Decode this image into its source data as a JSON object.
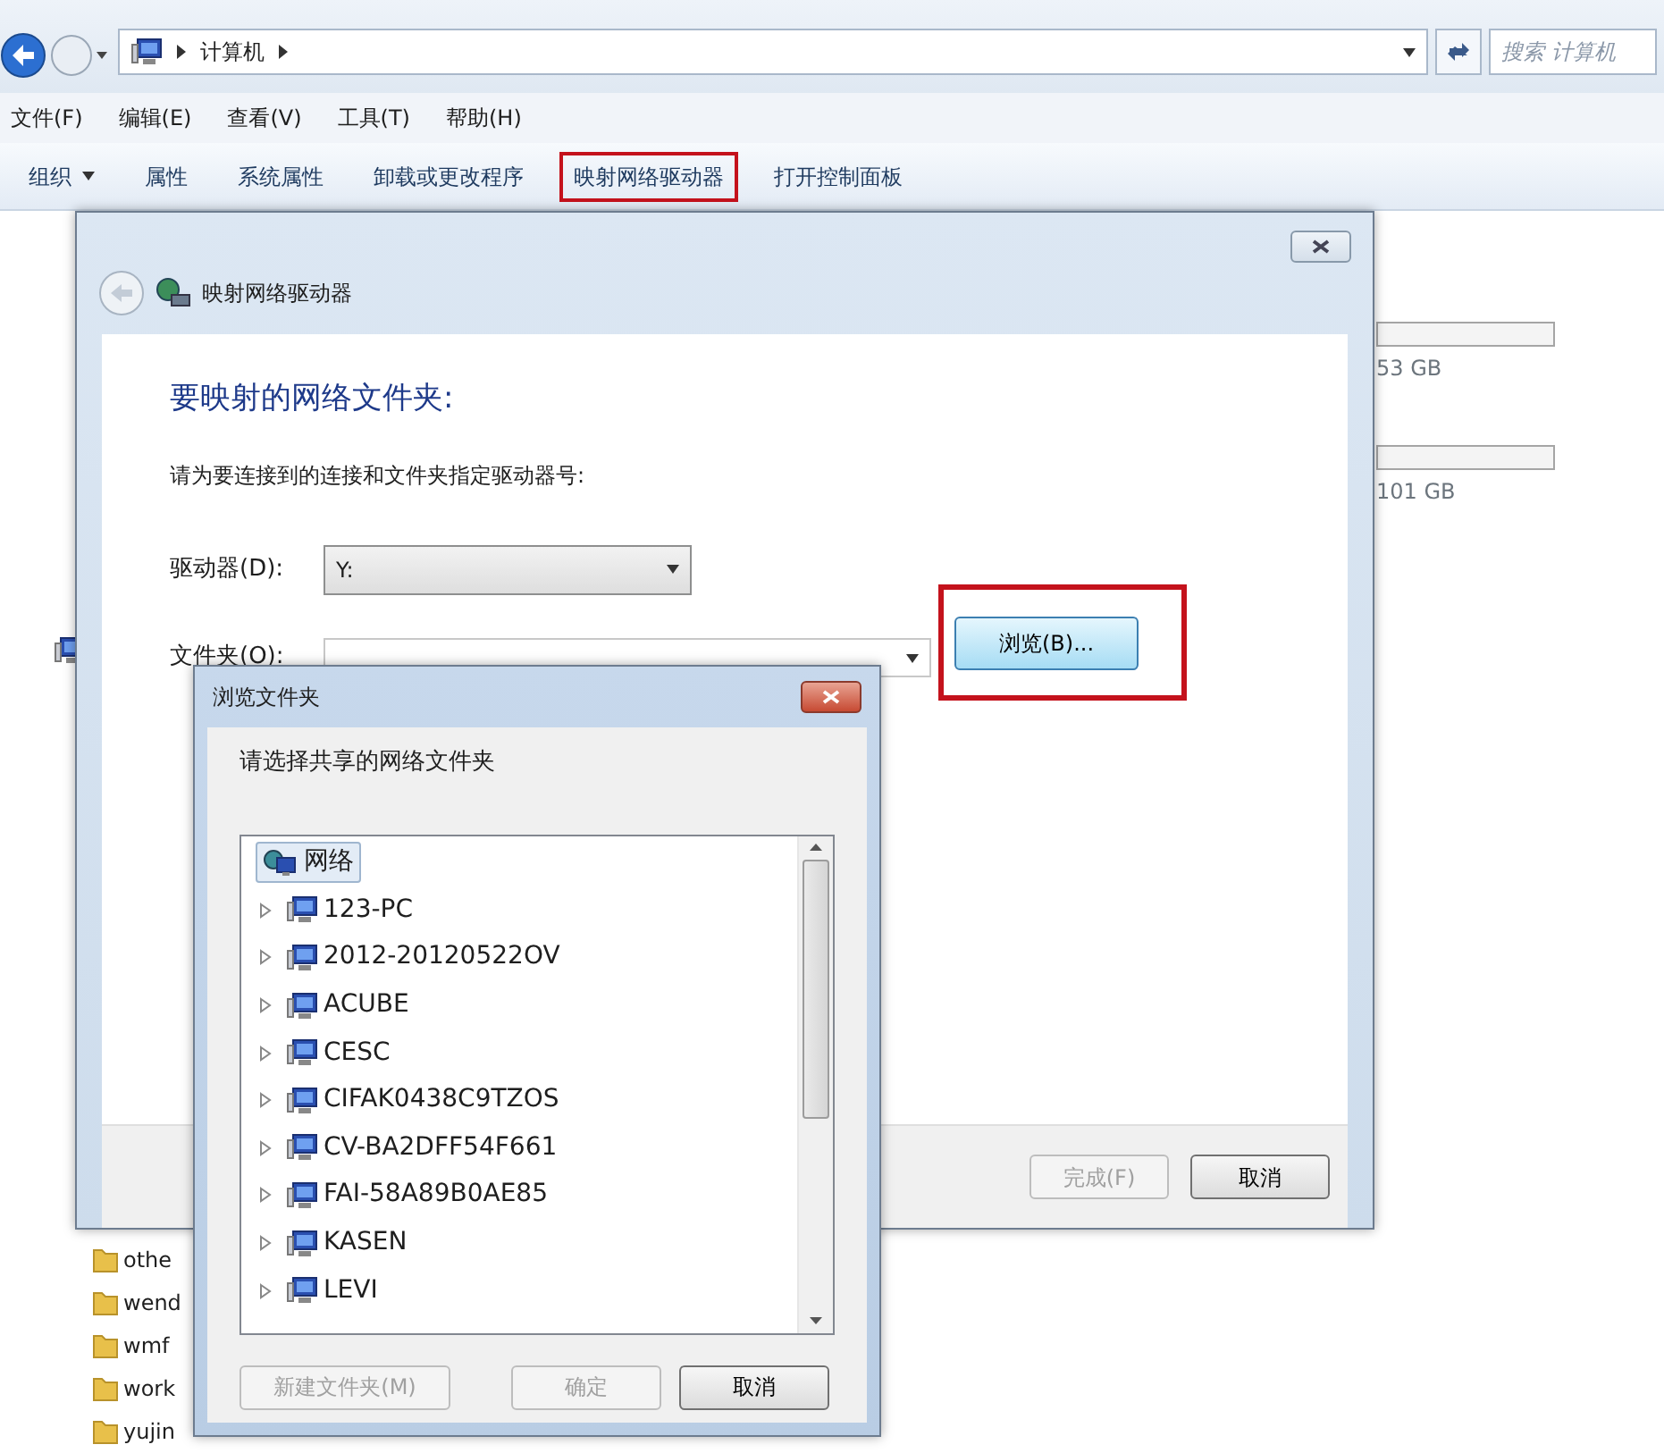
{
  "address_bar": {
    "segments": [
      "计算机"
    ]
  },
  "search": {
    "placeholder": "搜索 计算机"
  },
  "menu": [
    "文件(F)",
    "编辑(E)",
    "查看(V)",
    "工具(T)",
    "帮助(H)"
  ],
  "toolbar": [
    {
      "label": "组织",
      "dropdown": true,
      "highlighted": false
    },
    {
      "label": "属性",
      "dropdown": false,
      "highlighted": false
    },
    {
      "label": "系统属性",
      "dropdown": false,
      "highlighted": false
    },
    {
      "label": "卸载或更改程序",
      "dropdown": false,
      "highlighted": false
    },
    {
      "label": "映射网络驱动器",
      "dropdown": false,
      "highlighted": true
    },
    {
      "label": "打开控制面板",
      "dropdown": false,
      "highlighted": false
    }
  ],
  "drives": [
    {
      "level": 0,
      "free": "53 GB"
    },
    {
      "level": 0,
      "free": "101 GB"
    }
  ],
  "folders": [
    "othe",
    "wend",
    "wmf",
    "work",
    "yujin"
  ],
  "map_dialog": {
    "title": "映射网络驱动器",
    "heading": "要映射的网络文件夹:",
    "instruction": "请为要连接到的连接和文件夹指定驱动器号:",
    "drive_label": "驱动器(D):",
    "drive_value": "Y:",
    "folder_label": "文件夹(O):",
    "browse_button": {
      "label": "浏览(B)...",
      "highlighted": true
    },
    "buttons": [
      {
        "label": "完成(F)",
        "disabled": true
      },
      {
        "label": "取消",
        "disabled": false
      }
    ]
  },
  "browse_dialog": {
    "title": "浏览文件夹",
    "prompt": "请选择共享的网络文件夹",
    "tree": [
      {
        "label": "网络",
        "kind": "network",
        "selected": true,
        "children": [
          {
            "label": "123-PC",
            "kind": "computer",
            "selected": false,
            "expanded": false
          },
          {
            "label": "2012-20120522OV",
            "kind": "computer",
            "selected": false,
            "expanded": false
          },
          {
            "label": "ACUBE",
            "kind": "computer",
            "selected": false,
            "expanded": false
          },
          {
            "label": "CESC",
            "kind": "computer",
            "selected": false,
            "expanded": false
          },
          {
            "label": "CIFAK0438C9TZOS",
            "kind": "computer",
            "selected": false,
            "expanded": false
          },
          {
            "label": "CV-BA2DFF54F661",
            "kind": "computer",
            "selected": false,
            "expanded": false
          },
          {
            "label": "FAI-58A89B0AE85",
            "kind": "computer",
            "selected": false,
            "expanded": false
          },
          {
            "label": "KASEN",
            "kind": "computer",
            "selected": false,
            "expanded": false
          },
          {
            "label": "LEVI",
            "kind": "computer",
            "selected": false,
            "expanded": false
          }
        ]
      }
    ],
    "buttons": [
      {
        "label": "新建文件夹(M)",
        "disabled": true
      },
      {
        "label": "确定",
        "disabled": true
      },
      {
        "label": "取消",
        "disabled": false
      }
    ]
  }
}
